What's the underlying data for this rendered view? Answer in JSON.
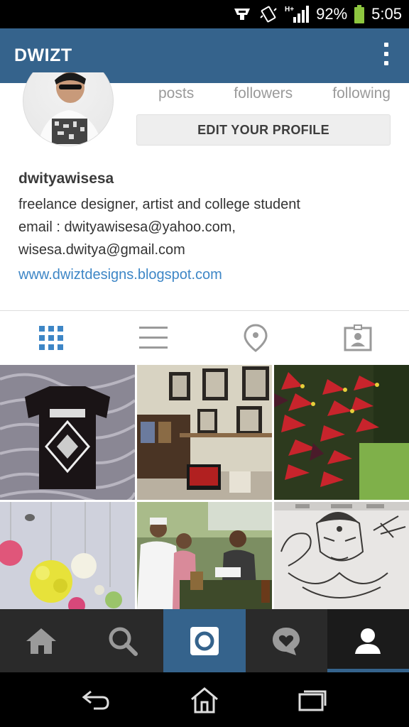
{
  "status_bar": {
    "battery": "92%",
    "time": "5:05",
    "network": "H+"
  },
  "app_bar": {
    "title": "DWIZT"
  },
  "profile": {
    "stats_labels": [
      "posts",
      "followers",
      "following"
    ],
    "edit_button": "EDIT YOUR PROFILE",
    "username": "dwityawisesa",
    "bio_lines": [
      "freelance designer, artist and college student",
      "email : dwityawisesa@yahoo.com,",
      "wisesa.dwitya@gmail.com"
    ],
    "website": "www.dwiztdesigns.blogspot.com"
  },
  "view_tabs": [
    "grid-view-icon",
    "list-view-icon",
    "map-pin-icon",
    "tagged-photos-icon"
  ],
  "photos": [
    "t-shirt",
    "studio-room",
    "red-flowers",
    "flower-balls",
    "people-at-table",
    "shiva-drawing"
  ],
  "bottom_nav": [
    "home-icon",
    "search-icon",
    "camera-icon",
    "activity-icon",
    "profile-icon"
  ],
  "colors": {
    "brand_blue": "#35638c",
    "link_blue": "#3d86c6",
    "dark_nav": "#2a2a2a"
  }
}
